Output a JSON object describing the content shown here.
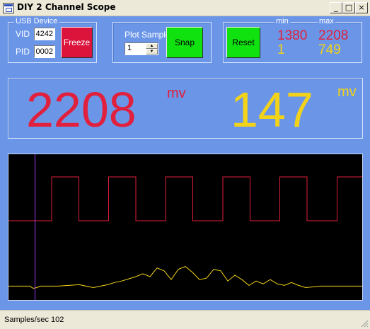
{
  "window": {
    "title": "DIY 2 Channel Scope"
  },
  "titlebar_buttons": {
    "minimize": "_",
    "maximize": "□",
    "close": "×"
  },
  "usb": {
    "group_label": "USB Device",
    "vid_label": "VID",
    "vid_value": "4242",
    "pid_label": "PID",
    "pid_value": "0002",
    "freeze_label": "Freeze"
  },
  "plot": {
    "label": "Plot Sample",
    "spin_value": "1",
    "snap_label": "Snap"
  },
  "stats": {
    "reset_label": "Reset",
    "min_label": "min",
    "max_label": "max",
    "ch1_min": "1380",
    "ch1_max": "2208",
    "ch2_min": "1",
    "ch2_max": "749"
  },
  "readout": {
    "ch1_value": "2208",
    "ch1_unit": "mv",
    "ch2_value": "147",
    "ch2_unit": "mv"
  },
  "colors": {
    "ch1": "#e0203c",
    "ch2": "#f3d317",
    "cursor": "#9b3cff",
    "accent": "#6b96e8"
  },
  "status": {
    "text": "Samples/sec 102"
  },
  "scope": {
    "square_high_starts": [
      0.122,
      0.283,
      0.444,
      0.606,
      0.767,
      0.929
    ],
    "square_high_width": 0.077,
    "cursor_position": 0.075,
    "yellow_trace": [
      [
        0,
        0.905
      ],
      [
        0.06,
        0.905
      ],
      [
        0.07,
        0.92
      ],
      [
        0.08,
        0.915
      ],
      [
        0.09,
        0.905
      ],
      [
        0.14,
        0.905
      ],
      [
        0.2,
        0.895
      ],
      [
        0.24,
        0.915
      ],
      [
        0.28,
        0.895
      ],
      [
        0.3,
        0.88
      ],
      [
        0.32,
        0.87
      ],
      [
        0.34,
        0.855
      ],
      [
        0.36,
        0.84
      ],
      [
        0.38,
        0.82
      ],
      [
        0.4,
        0.84
      ],
      [
        0.42,
        0.78
      ],
      [
        0.44,
        0.8
      ],
      [
        0.46,
        0.86
      ],
      [
        0.48,
        0.79
      ],
      [
        0.5,
        0.77
      ],
      [
        0.52,
        0.81
      ],
      [
        0.54,
        0.86
      ],
      [
        0.56,
        0.85
      ],
      [
        0.58,
        0.79
      ],
      [
        0.6,
        0.8
      ],
      [
        0.62,
        0.87
      ],
      [
        0.64,
        0.83
      ],
      [
        0.66,
        0.86
      ],
      [
        0.68,
        0.9
      ],
      [
        0.7,
        0.87
      ],
      [
        0.72,
        0.89
      ],
      [
        0.74,
        0.86
      ],
      [
        0.76,
        0.89
      ],
      [
        0.78,
        0.9
      ],
      [
        0.8,
        0.88
      ],
      [
        0.82,
        0.9
      ],
      [
        0.84,
        0.915
      ],
      [
        0.86,
        0.91
      ],
      [
        0.88,
        0.905
      ],
      [
        0.9,
        0.905
      ],
      [
        0.94,
        0.905
      ],
      [
        1,
        0.905
      ]
    ]
  }
}
